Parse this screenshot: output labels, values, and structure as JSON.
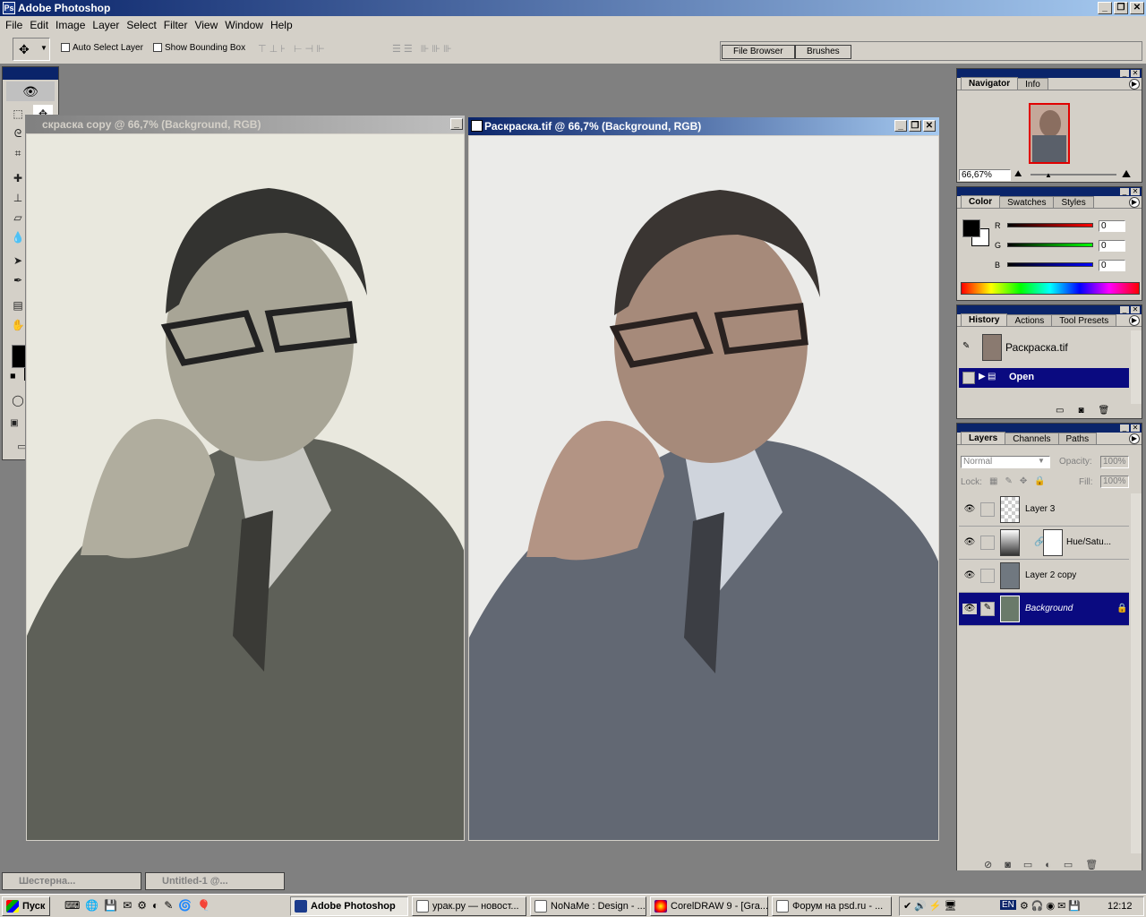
{
  "app": {
    "title": "Adobe Photoshop"
  },
  "window_controls": {
    "minimize": "_",
    "maximize": "❐",
    "close": "✕"
  },
  "menu": [
    "File",
    "Edit",
    "Image",
    "Layer",
    "Select",
    "Filter",
    "View",
    "Window",
    "Help"
  ],
  "options": {
    "auto_select_layer": "Auto Select Layer",
    "show_bounding_box": "Show Bounding Box",
    "file_browser_tab": "File Browser",
    "brushes_tab": "Brushes"
  },
  "documents": [
    {
      "title": "скраска copy @ 66,7% (Background, RGB)",
      "active": false
    },
    {
      "title": "Раскраска.tif @ 66,7% (Background, RGB)",
      "active": true
    }
  ],
  "navigator": {
    "tabs": [
      "Navigator",
      "Info"
    ],
    "zoom": "66,67%"
  },
  "color": {
    "tabs": [
      "Color",
      "Swatches",
      "Styles"
    ],
    "channels": [
      {
        "label": "R",
        "value": "0",
        "color": "#cc0000"
      },
      {
        "label": "G",
        "value": "0",
        "color": "#00aa00"
      },
      {
        "label": "B",
        "value": "0",
        "color": "#0000cc"
      }
    ]
  },
  "history": {
    "tabs": [
      "History",
      "Actions",
      "Tool Presets"
    ],
    "snapshot": "Раскраска.tif",
    "states": [
      "Open"
    ]
  },
  "layers": {
    "tabs": [
      "Layers",
      "Channels",
      "Paths"
    ],
    "blend_mode": "Normal",
    "opacity_label": "Opacity:",
    "opacity": "100%",
    "lock_label": "Lock:",
    "fill_label": "Fill:",
    "fill": "100%",
    "items": [
      {
        "name": "Layer 3",
        "selected": false
      },
      {
        "name": "Hue/Satu...",
        "selected": false
      },
      {
        "name": "Layer 2 copy",
        "selected": false
      },
      {
        "name": "Background",
        "selected": true
      }
    ]
  },
  "minimized_docs": [
    "Шестерна...",
    "Untitled-1 @..."
  ],
  "taskbar": {
    "start": "Пуск",
    "tasks": [
      "Adobe Photoshop",
      "урак.ру — новост...",
      "NoNaMe : Design - ...",
      "CorelDRAW 9 - [Gra...",
      "Форум на psd.ru - ..."
    ],
    "lang": "EN",
    "clock": "12:12"
  },
  "colors": {
    "titlebar_active": "#0a246a",
    "face": "#d4d0c8",
    "workspace": "#808080",
    "selection": "#0a0a80"
  }
}
